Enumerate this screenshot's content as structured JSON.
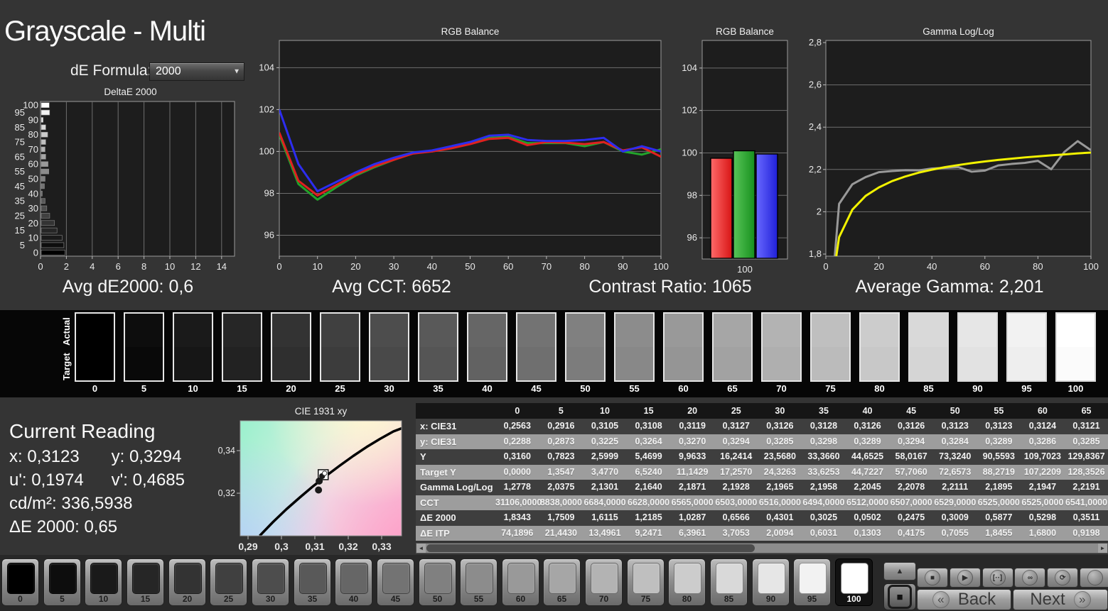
{
  "header": {
    "title": "Grayscale - Multi",
    "de_formula_label": "dE Formula:",
    "de_formula_value": "2000"
  },
  "stats": [
    "Avg dE2000: 0,6",
    "Avg CCT: 6652",
    "Contrast Ratio: 1065",
    "Average Gamma: 2,201"
  ],
  "grayscale_band": {
    "actual_label": "Actual",
    "target_label": "Target",
    "levels": [
      0,
      5,
      10,
      15,
      20,
      25,
      30,
      35,
      40,
      45,
      50,
      55,
      60,
      65,
      70,
      75,
      80,
      85,
      90,
      95,
      100
    ]
  },
  "current_reading": {
    "title": "Current Reading",
    "x_label": "x:",
    "x_value": "0,3123",
    "y_label": "y:",
    "y_value": "0,3294",
    "u_label": "u':",
    "u_value": "0,1974",
    "v_label": "v':",
    "v_value": "0,4685",
    "lum_label": "cd/m²:",
    "lum_value": "336,5938",
    "de_label": "ΔE 2000:",
    "de_value": "0,65"
  },
  "table": {
    "columns": [
      "0",
      "5",
      "10",
      "15",
      "20",
      "25",
      "30",
      "35",
      "40",
      "45",
      "50",
      "55",
      "60",
      "65"
    ],
    "rows": [
      {
        "label": "x: CIE31",
        "values": [
          "0,2563",
          "0,2916",
          "0,3105",
          "0,3108",
          "0,3119",
          "0,3127",
          "0,3126",
          "0,3128",
          "0,3126",
          "0,3126",
          "0,3123",
          "0,3123",
          "0,3124",
          "0,3121"
        ]
      },
      {
        "label": "y: CIE31",
        "values": [
          "0,2288",
          "0,2873",
          "0,3225",
          "0,3264",
          "0,3270",
          "0,3294",
          "0,3285",
          "0,3298",
          "0,3289",
          "0,3294",
          "0,3284",
          "0,3289",
          "0,3286",
          "0,3285"
        ]
      },
      {
        "label": "Y",
        "values": [
          "0,3160",
          "0,7823",
          "2,5999",
          "5,4699",
          "9,9633",
          "16,2414",
          "23,5680",
          "33,3660",
          "44,6525",
          "58,0167",
          "73,3240",
          "90,5593",
          "109,7023",
          "129,8367"
        ]
      },
      {
        "label": "Target Y",
        "values": [
          "0,0000",
          "1,3547",
          "3,4770",
          "6,5240",
          "11,1429",
          "17,2570",
          "24,3263",
          "33,6253",
          "44,7227",
          "57,7060",
          "72,6573",
          "88,2719",
          "107,2209",
          "128,3526"
        ]
      },
      {
        "label": "Gamma Log/Log",
        "values": [
          "1,2778",
          "2,0375",
          "2,1301",
          "2,1640",
          "2,1871",
          "2,1928",
          "2,1965",
          "2,1958",
          "2,2045",
          "2,2078",
          "2,2111",
          "2,1895",
          "2,1947",
          "2,2191"
        ]
      },
      {
        "label": "CCT",
        "values": [
          "31106,0000",
          "8838,0000",
          "6684,0000",
          "6628,0000",
          "6565,0000",
          "6503,0000",
          "6516,0000",
          "6494,0000",
          "6512,0000",
          "6507,0000",
          "6529,0000",
          "6525,0000",
          "6525,0000",
          "6541,0000"
        ]
      },
      {
        "label": "ΔE 2000",
        "values": [
          "1,8343",
          "1,7509",
          "1,6115",
          "1,2185",
          "1,0287",
          "0,6566",
          "0,4301",
          "0,3025",
          "0,0502",
          "0,2475",
          "0,3009",
          "0,5877",
          "0,5298",
          "0,3511"
        ]
      },
      {
        "label": "ΔE ITP",
        "values": [
          "74,1896",
          "21,4430",
          "13,4961",
          "9,2471",
          "6,3961",
          "3,7053",
          "2,0094",
          "0,6031",
          "0,1303",
          "0,4175",
          "0,7055",
          "1,8455",
          "1,6800",
          "0,9198"
        ]
      }
    ]
  },
  "scrollbar": {
    "left_arrow": "◄",
    "right_arrow": "►"
  },
  "bottom_bar": {
    "levels": [
      0,
      5,
      10,
      15,
      20,
      25,
      30,
      35,
      40,
      45,
      50,
      55,
      60,
      65,
      70,
      75,
      80,
      85,
      90,
      95,
      100
    ],
    "selected_level": 100,
    "up_icon": "▲",
    "full_field_icon": "■",
    "controls": [
      {
        "name": "stop",
        "glyph": "■"
      },
      {
        "name": "play",
        "glyph": "▶"
      },
      {
        "name": "pattern",
        "glyph": "[··]"
      },
      {
        "name": "loop",
        "glyph": "∞"
      },
      {
        "name": "refresh",
        "glyph": "⟳"
      },
      {
        "name": "record",
        "glyph": ""
      }
    ],
    "back_chevron": "«",
    "back_label": "Back",
    "next_label": "Next",
    "next_chevron": "»"
  },
  "colors": {
    "red": "#e02020",
    "green": "#22a32b",
    "blue": "#2d2def",
    "yellow": "#f2f200",
    "measured_gray": "#999999",
    "chart_bg": "#1d1d1d",
    "page_bg": "#343434"
  },
  "chart_data": [
    {
      "id": "deltae",
      "type": "bar",
      "orientation": "horizontal",
      "title": "DeltaE 2000",
      "categories": [
        0,
        5,
        10,
        15,
        20,
        25,
        30,
        35,
        40,
        45,
        50,
        55,
        60,
        65,
        70,
        75,
        80,
        85,
        90,
        95,
        100
      ],
      "values": [
        1.8343,
        1.7509,
        1.6115,
        1.2185,
        1.0287,
        0.6566,
        0.4301,
        0.3025,
        0.0502,
        0.2475,
        0.3009,
        0.5877,
        0.5298,
        0.3511,
        0.3,
        0.35,
        0.5,
        0.35,
        0.15,
        0.65,
        0.62
      ],
      "xlabel": "",
      "ylabel": "",
      "xlim": [
        0,
        15
      ],
      "x_ticks": [
        0,
        2,
        4,
        6,
        8,
        10,
        12,
        14
      ],
      "grid": true
    },
    {
      "id": "rgb_line",
      "type": "line",
      "title": "RGB Balance",
      "x": [
        0,
        5,
        10,
        15,
        20,
        25,
        30,
        35,
        40,
        45,
        50,
        55,
        60,
        65,
        70,
        75,
        80,
        85,
        90,
        95,
        100
      ],
      "ylim": [
        95,
        105.3
      ],
      "y_ticks": [
        96,
        98,
        100,
        102,
        104
      ],
      "x_ticks": [
        0,
        10,
        20,
        30,
        40,
        50,
        60,
        70,
        80,
        90,
        100
      ],
      "grid": true,
      "series": [
        {
          "name": "green",
          "color": "#22a32b",
          "values": [
            100.8,
            98.45,
            97.7,
            98.3,
            98.85,
            99.25,
            99.6,
            99.95,
            100.0,
            100.2,
            100.4,
            100.65,
            100.7,
            100.4,
            100.4,
            100.4,
            100.25,
            100.45,
            100.0,
            99.85,
            100.1
          ]
        },
        {
          "name": "red",
          "color": "#e02020",
          "values": [
            100.9,
            98.6,
            97.9,
            98.4,
            98.9,
            99.3,
            99.6,
            99.9,
            100.0,
            100.15,
            100.35,
            100.6,
            100.65,
            100.3,
            100.45,
            100.42,
            100.35,
            100.45,
            100.05,
            100.2,
            99.75
          ]
        },
        {
          "name": "blue",
          "color": "#2d2def",
          "values": [
            102.0,
            99.4,
            98.1,
            98.55,
            99.0,
            99.4,
            99.7,
            99.95,
            100.05,
            100.25,
            100.45,
            100.75,
            100.8,
            100.55,
            100.5,
            100.5,
            100.55,
            100.65,
            100.0,
            100.25,
            100.0
          ]
        }
      ]
    },
    {
      "id": "rgb_bar",
      "type": "bar",
      "title": "RGB Balance",
      "categories": [
        "red",
        "green",
        "blue"
      ],
      "values": [
        99.75,
        100.1,
        99.95
      ],
      "x_label": "100",
      "ylim": [
        95,
        105.3
      ],
      "y_ticks": [
        96,
        98,
        100,
        102,
        104
      ],
      "grid": true
    },
    {
      "id": "gamma",
      "type": "line",
      "title": "Gamma Log/Log",
      "x": [
        0,
        5,
        10,
        15,
        20,
        25,
        30,
        35,
        40,
        45,
        50,
        55,
        60,
        65,
        70,
        75,
        80,
        85,
        90,
        95,
        100
      ],
      "ylim": [
        1.79,
        2.81
      ],
      "y_ticks": [
        {
          "v": 1.8,
          "label": "1,8"
        },
        {
          "v": 2.0,
          "label": "2"
        },
        {
          "v": 2.2,
          "label": "2,2"
        },
        {
          "v": 2.4,
          "label": "2,4"
        },
        {
          "v": 2.6,
          "label": "2,6"
        },
        {
          "v": 2.8,
          "label": "2,8"
        }
      ],
      "x_ticks": [
        0,
        20,
        40,
        60,
        80,
        100
      ],
      "grid": true,
      "series": [
        {
          "name": "measured",
          "color": "#999999",
          "values": [
            1.2778,
            2.0375,
            2.1301,
            2.164,
            2.1871,
            2.1928,
            2.1965,
            2.1958,
            2.2045,
            2.2078,
            2.2111,
            2.1895,
            2.1947,
            2.2191,
            2.226,
            2.231,
            2.241,
            2.201,
            2.283,
            2.334,
            2.291
          ]
        },
        {
          "name": "reference",
          "color": "#f2f200",
          "values": [
            1.45,
            1.88,
            2.01,
            2.075,
            2.115,
            2.145,
            2.167,
            2.185,
            2.199,
            2.211,
            2.221,
            2.23,
            2.238,
            2.245,
            2.251,
            2.257,
            2.262,
            2.267,
            2.271,
            2.276,
            2.28
          ]
        }
      ]
    },
    {
      "id": "cie",
      "type": "scatter",
      "title": "CIE 1931 xy",
      "xlim": [
        0.2877,
        0.336
      ],
      "ylim": [
        0.3,
        0.354
      ],
      "x_ticks": [
        {
          "v": 0.29,
          "label": "0,29"
        },
        {
          "v": 0.3,
          "label": "0,3"
        },
        {
          "v": 0.31,
          "label": "0,31"
        },
        {
          "v": 0.32,
          "label": "0,32"
        },
        {
          "v": 0.33,
          "label": "0,33"
        }
      ],
      "y_ticks": [
        {
          "v": 0.32,
          "label": "0,32"
        },
        {
          "v": 0.34,
          "label": "0,34"
        }
      ],
      "locus": [
        [
          0.2935,
          0.3
        ],
        [
          0.2975,
          0.3065
        ],
        [
          0.3015,
          0.3125
        ],
        [
          0.3055,
          0.318
        ],
        [
          0.3095,
          0.3233
        ],
        [
          0.3135,
          0.3283
        ],
        [
          0.3175,
          0.333
        ],
        [
          0.3215,
          0.3375
        ],
        [
          0.3255,
          0.3417
        ],
        [
          0.3295,
          0.3455
        ],
        [
          0.3335,
          0.349
        ],
        [
          0.336,
          0.3505
        ]
      ],
      "points": [
        {
          "x": 0.3125,
          "y": 0.3287,
          "marker": "square"
        },
        {
          "x": 0.3113,
          "y": 0.3257,
          "marker": "dot"
        },
        {
          "x": 0.3111,
          "y": 0.3215,
          "marker": "dot"
        }
      ]
    }
  ]
}
